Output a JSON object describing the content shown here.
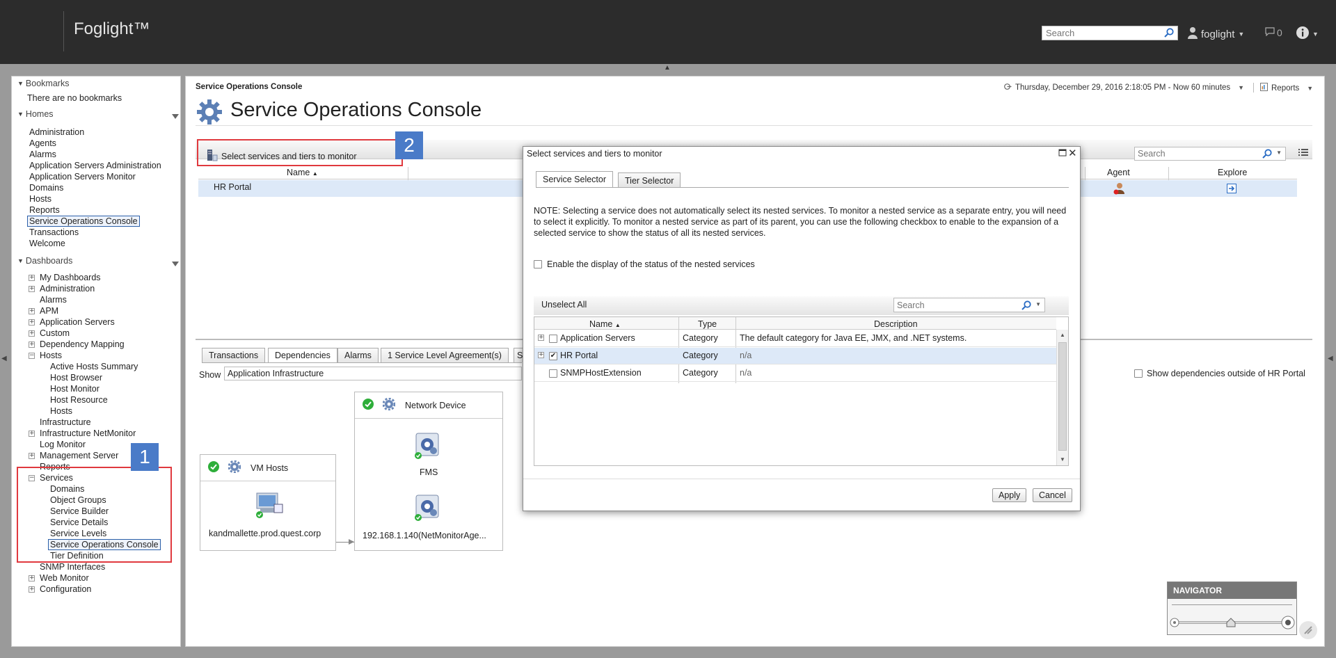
{
  "app": {
    "brand": "Foglight™"
  },
  "topbar": {
    "search_placeholder": "Search",
    "user": "foglight",
    "messages": "0"
  },
  "sidebar": {
    "bookmarks_header": "Bookmarks",
    "no_bookmarks": "There are no bookmarks",
    "homes_header": "Homes",
    "homes": [
      "Administration",
      "Agents",
      "Alarms",
      "Application Servers Administration",
      "Application Servers Monitor",
      "Domains",
      "Hosts",
      "Reports",
      "Service Operations Console",
      "Transactions",
      "Welcome"
    ],
    "dashboards_header": "Dashboards",
    "dashboards": {
      "my_dashboards": "My Dashboards",
      "administration": "Administration",
      "alarms": "Alarms",
      "apm": "APM",
      "application_servers": "Application Servers",
      "custom": "Custom",
      "dependency_mapping": "Dependency Mapping",
      "hosts": "Hosts",
      "hosts_children": [
        "Active Hosts Summary",
        "Host Browser",
        "Host Monitor",
        "Host Resource",
        "Hosts"
      ],
      "infrastructure": "Infrastructure",
      "infrastructure_netmonitor": "Infrastructure NetMonitor",
      "log_monitor": "Log Monitor",
      "management_server": "Management Server",
      "reports": "Reports",
      "services": "Services",
      "services_children": [
        "Domains",
        "Object Groups",
        "Service Builder",
        "Service Details",
        "Service Levels",
        "Service Operations Console",
        "Tier Definition"
      ],
      "snmp_interfaces": "SNMP Interfaces",
      "web_monitor": "Web Monitor",
      "configuration": "Configuration"
    }
  },
  "main": {
    "breadcrumb": "Service Operations Console",
    "time_range": "Thursday, December 29, 2016 2:18:05 PM - Now 60 minutes",
    "reports": "Reports",
    "title": "Service Operations Console",
    "select_link": "Select services and tiers to monitor",
    "search_placeholder": "Search",
    "columns": {
      "name": "Name",
      "agent": "Agent",
      "explore": "Explore"
    },
    "row_name": "HR Portal",
    "tabs": [
      "Transactions",
      "Dependencies",
      "Alarms",
      "1 Service Level Agreement(s)",
      "S"
    ],
    "show_label": "Show",
    "show_value": "Application Infrastructure",
    "outside_label": "Show dependencies outside of HR Portal",
    "deps": {
      "vm_hosts": {
        "title": "VM Hosts",
        "items": [
          "kandmallette.prod.quest.corp"
        ]
      },
      "network_device": {
        "title": "Network Device",
        "items": [
          "FMS",
          "192.168.1.140(NetMonitorAge..."
        ]
      }
    },
    "navigator": "NAVIGATOR"
  },
  "dialog": {
    "title": "Select services and tiers to monitor",
    "tabs": [
      "Service Selector",
      "Tier Selector"
    ],
    "note": "NOTE: Selecting a service does not automatically select its nested services. To monitor a nested service as a separate entry, you will need to select it explicitly. To monitor a nested service as part of its parent, you can use the following checkbox to enable to the expansion of a selected service to show the status of all its nested services.",
    "nested_label": "Enable the display of the status of the nested services",
    "unselect_all": "Unselect All",
    "search_placeholder": "Search",
    "columns": {
      "name": "Name",
      "type": "Type",
      "description": "Description"
    },
    "rows": [
      {
        "name": "Application Servers",
        "type": "Category",
        "description": "The default category for Java EE, JMX, and .NET systems.",
        "checked": false
      },
      {
        "name": "HR Portal",
        "type": "Category",
        "description": "n/a",
        "checked": true
      },
      {
        "name": "SNMPHostExtension",
        "type": "Category",
        "description": "n/a",
        "checked": false
      }
    ],
    "apply": "Apply",
    "cancel": "Cancel"
  },
  "callouts": [
    "1",
    "2"
  ],
  "colors": {
    "topbar": "#2c2c2c",
    "selected_row": "#dde9f8",
    "callout_border": "#e0393e",
    "callout_badge": "#4a7bc8",
    "ok_green": "#2eae3a"
  }
}
